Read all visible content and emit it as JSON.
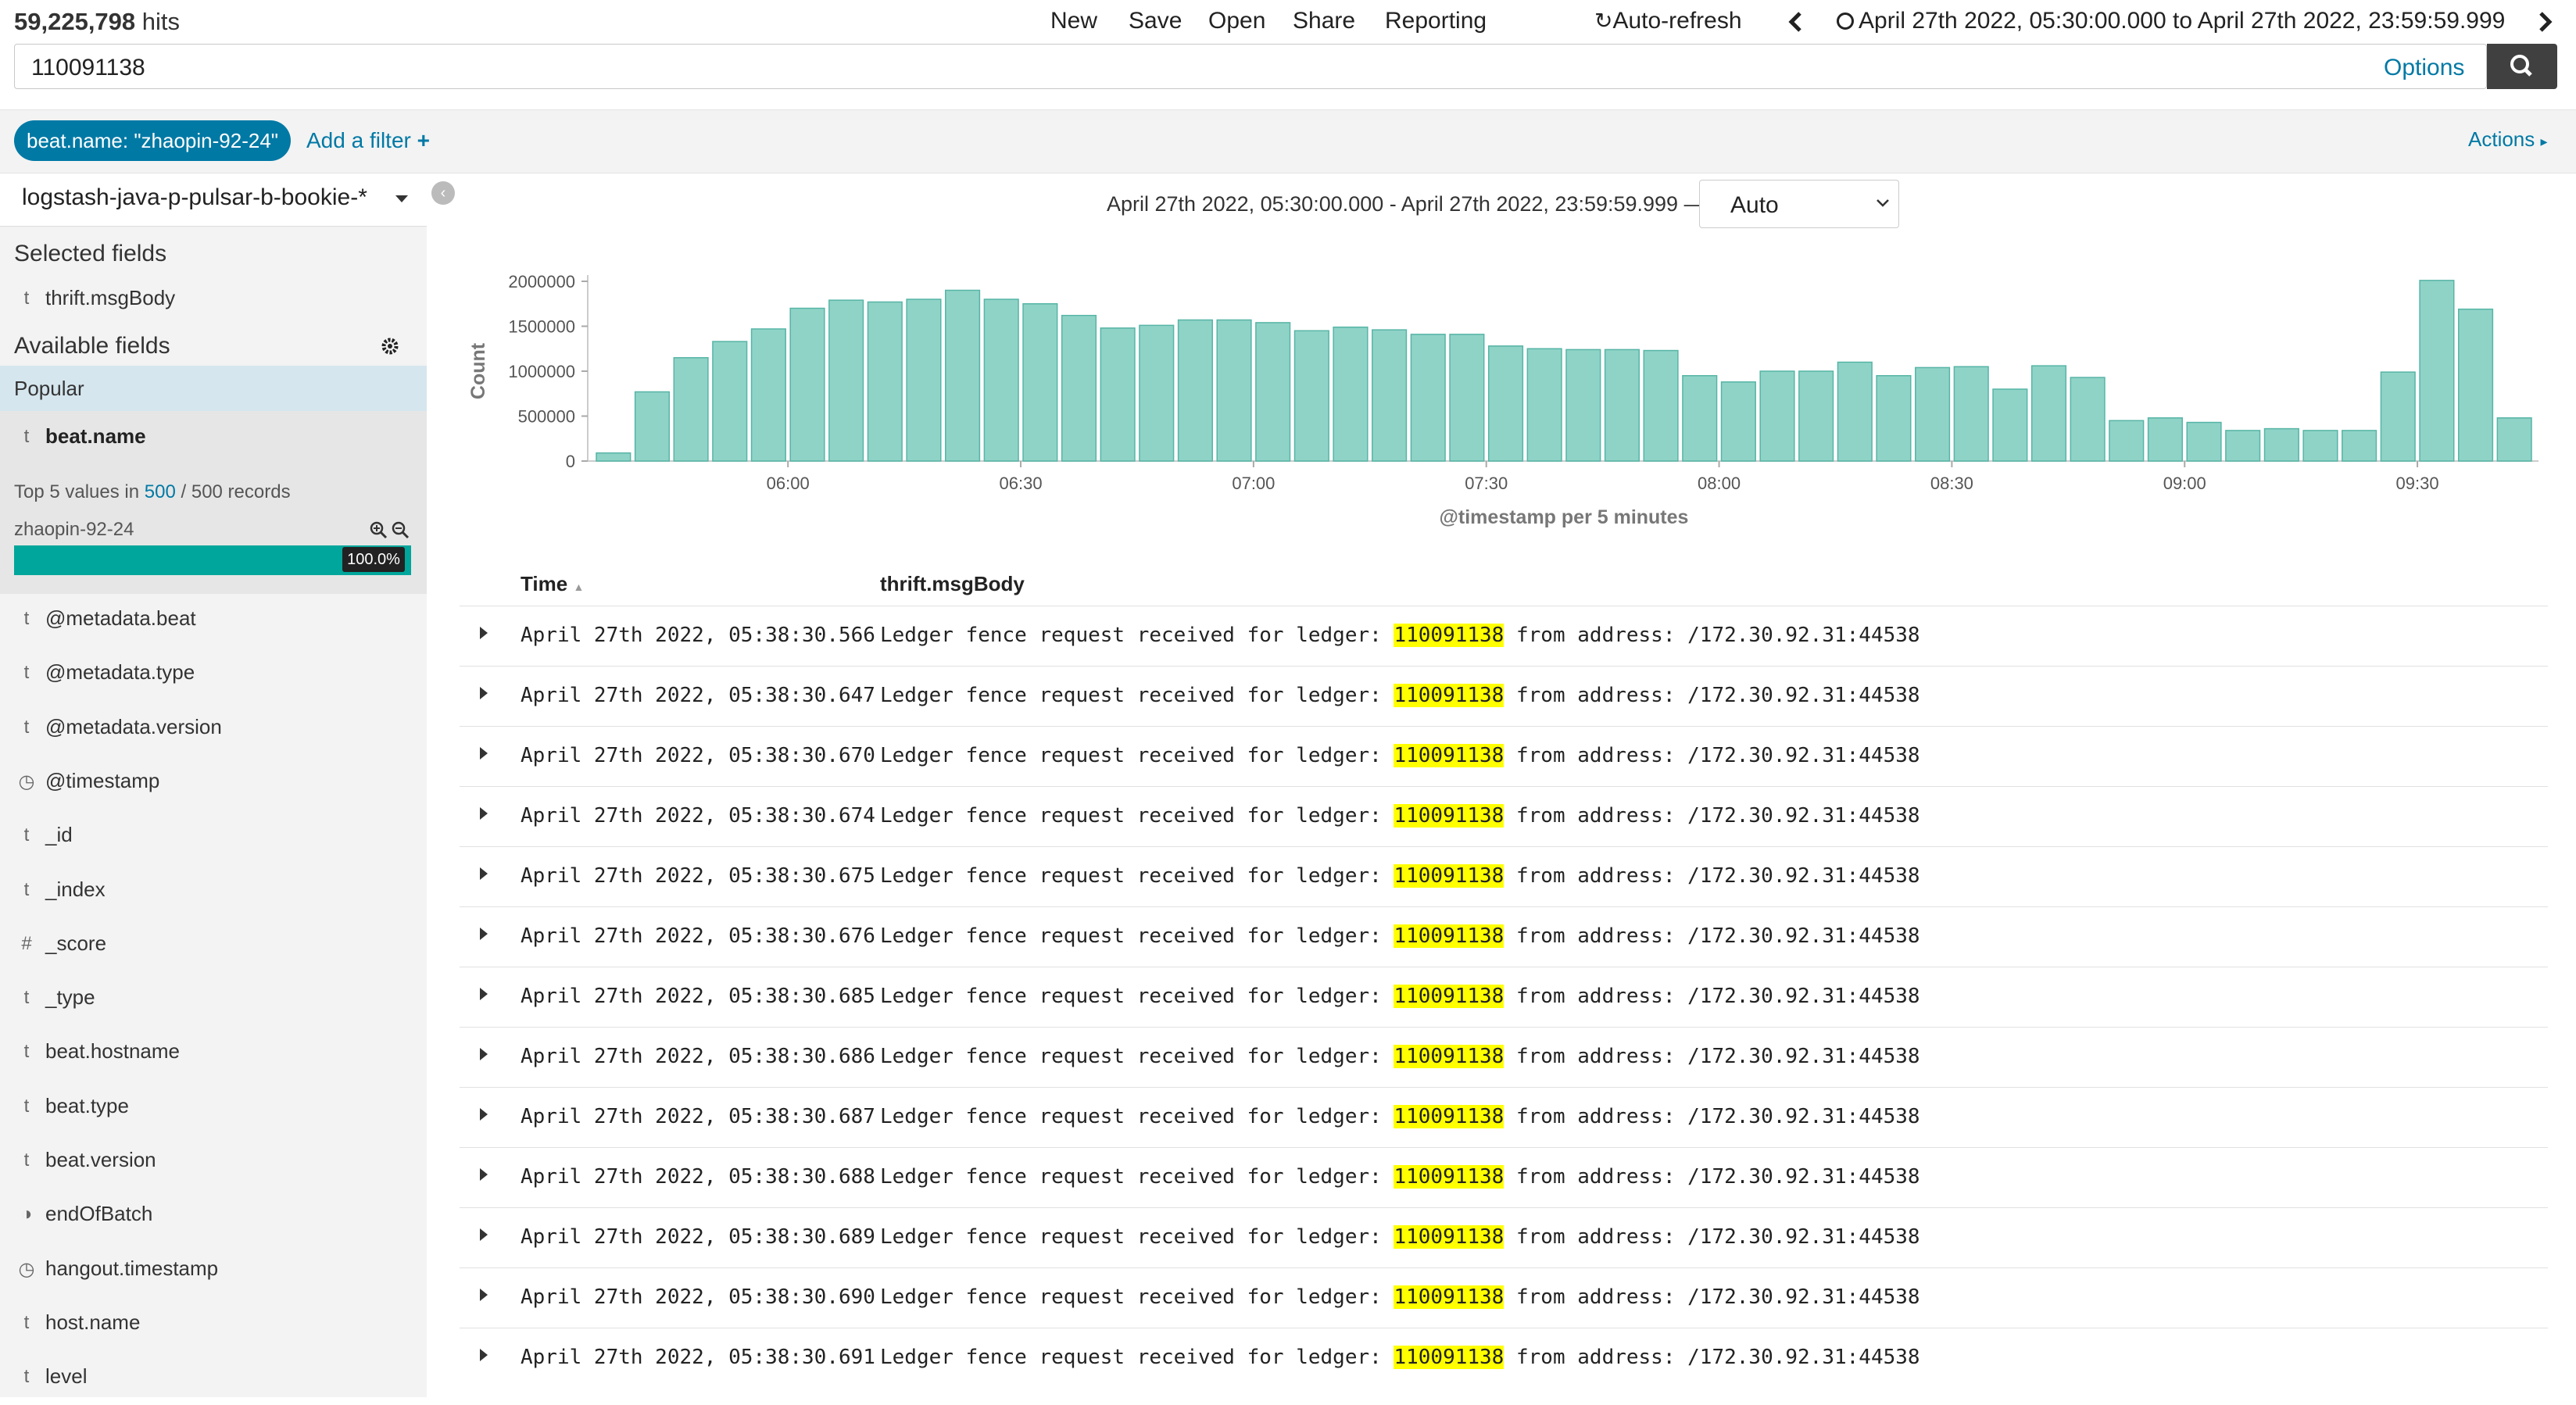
{
  "header": {
    "hits_count": "59,225,798",
    "hits_label": "hits",
    "menu": [
      "New",
      "Save",
      "Open",
      "Share",
      "Reporting"
    ],
    "auto_refresh": "Auto-refresh",
    "time_range": "April 27th 2022, 05:30:00.000 to April 27th 2022, 23:59:59.999"
  },
  "query": {
    "value": "110091138",
    "options_label": "Options"
  },
  "filters": {
    "pill": "beat.name: \"zhaopin-92-24\"",
    "add_filter": "Add a filter",
    "actions": "Actions"
  },
  "sidebar": {
    "index_pattern": "logstash-java-p-pulsar-b-bookie-*",
    "selected_fields_title": "Selected fields",
    "selected_fields": [
      {
        "type": "t",
        "name": "thrift.msgBody"
      }
    ],
    "available_fields_title": "Available fields",
    "popular_title": "Popular",
    "popular_field": {
      "type": "t",
      "name": "beat.name"
    },
    "top5": {
      "prefix": "Top 5 values in",
      "count": "500",
      "sep": "/",
      "total": "500 records"
    },
    "top_value": {
      "name": "zhaopin-92-24",
      "percent_label": "100.0%",
      "percent": 100
    },
    "fields": [
      {
        "type": "t",
        "name": "@metadata.beat"
      },
      {
        "type": "t",
        "name": "@metadata.type"
      },
      {
        "type": "t",
        "name": "@metadata.version"
      },
      {
        "type": "clock",
        "name": "@timestamp"
      },
      {
        "type": "t",
        "name": "_id"
      },
      {
        "type": "t",
        "name": "_index"
      },
      {
        "type": "#",
        "name": "_score"
      },
      {
        "type": "t",
        "name": "_type"
      },
      {
        "type": "t",
        "name": "beat.hostname"
      },
      {
        "type": "t",
        "name": "beat.type"
      },
      {
        "type": "t",
        "name": "beat.version"
      },
      {
        "type": "bool",
        "name": "endOfBatch"
      },
      {
        "type": "clock",
        "name": "hangout.timestamp"
      },
      {
        "type": "t",
        "name": "host.name"
      },
      {
        "type": "t",
        "name": "level"
      }
    ]
  },
  "main": {
    "range_text": "April 27th 2022, 05:30:00.000 - April 27th 2022, 23:59:59.999 —",
    "interval": "Auto",
    "table_headers": {
      "time": "Time",
      "msg": "thrift.msgBody"
    },
    "rows": [
      {
        "time": "April 27th 2022, 05:38:30.566",
        "pre": "Ledger fence request received for ledger:",
        "hl": "110091138",
        "post": "from address: /172.30.92.31:44538"
      },
      {
        "time": "April 27th 2022, 05:38:30.647",
        "pre": "Ledger fence request received for ledger:",
        "hl": "110091138",
        "post": "from address: /172.30.92.31:44538"
      },
      {
        "time": "April 27th 2022, 05:38:30.670",
        "pre": "Ledger fence request received for ledger:",
        "hl": "110091138",
        "post": "from address: /172.30.92.31:44538"
      },
      {
        "time": "April 27th 2022, 05:38:30.674",
        "pre": "Ledger fence request received for ledger:",
        "hl": "110091138",
        "post": "from address: /172.30.92.31:44538"
      },
      {
        "time": "April 27th 2022, 05:38:30.675",
        "pre": "Ledger fence request received for ledger:",
        "hl": "110091138",
        "post": "from address: /172.30.92.31:44538"
      },
      {
        "time": "April 27th 2022, 05:38:30.676",
        "pre": "Ledger fence request received for ledger:",
        "hl": "110091138",
        "post": "from address: /172.30.92.31:44538"
      },
      {
        "time": "April 27th 2022, 05:38:30.685",
        "pre": "Ledger fence request received for ledger:",
        "hl": "110091138",
        "post": "from address: /172.30.92.31:44538"
      },
      {
        "time": "April 27th 2022, 05:38:30.686",
        "pre": "Ledger fence request received for ledger:",
        "hl": "110091138",
        "post": "from address: /172.30.92.31:44538"
      },
      {
        "time": "April 27th 2022, 05:38:30.687",
        "pre": "Ledger fence request received for ledger:",
        "hl": "110091138",
        "post": "from address: /172.30.92.31:44538"
      },
      {
        "time": "April 27th 2022, 05:38:30.688",
        "pre": "Ledger fence request received for ledger:",
        "hl": "110091138",
        "post": "from address: /172.30.92.31:44538"
      },
      {
        "time": "April 27th 2022, 05:38:30.689",
        "pre": "Ledger fence request received for ledger:",
        "hl": "110091138",
        "post": "from address: /172.30.92.31:44538"
      },
      {
        "time": "April 27th 2022, 05:38:30.690",
        "pre": "Ledger fence request received for ledger:",
        "hl": "110091138",
        "post": "from address: /172.30.92.31:44538"
      },
      {
        "time": "April 27th 2022, 05:38:30.691",
        "pre": "Ledger fence request received for ledger:",
        "hl": "110091138",
        "post": "from address: /172.30.92.31:44538"
      }
    ]
  },
  "chart_data": {
    "type": "bar",
    "xlabel": "@timestamp per 5 minutes",
    "ylabel": "Count",
    "ylim": [
      0,
      2000000
    ],
    "yticks": [
      "0",
      "500000",
      "1000000",
      "1500000",
      "2000000"
    ],
    "xtick_labels": [
      "06:00",
      "06:30",
      "07:00",
      "07:30",
      "08:00",
      "08:30",
      "09:00",
      "09:30"
    ],
    "xtick_bar_index": [
      5,
      11,
      17,
      23,
      29,
      35,
      41,
      47
    ],
    "color": "#8fd3c7",
    "values": [
      90000,
      770000,
      1150000,
      1330000,
      1470000,
      1700000,
      1790000,
      1770000,
      1800000,
      1900000,
      1800000,
      1750000,
      1620000,
      1480000,
      1510000,
      1570000,
      1570000,
      1540000,
      1450000,
      1490000,
      1460000,
      1410000,
      1410000,
      1280000,
      1250000,
      1240000,
      1240000,
      1230000,
      950000,
      880000,
      1000000,
      1000000,
      1100000,
      950000,
      1040000,
      1050000,
      800000,
      1060000,
      930000,
      450000,
      480000,
      430000,
      340000,
      360000,
      340000,
      340000,
      990000,
      2010000,
      1690000,
      480000
    ]
  }
}
